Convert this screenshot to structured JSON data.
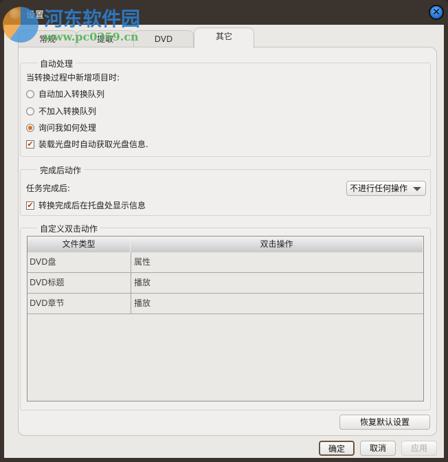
{
  "window": {
    "title": "设置",
    "watermark": {
      "name": "河东软件园",
      "url": "www.pc0359.cn"
    }
  },
  "tabs": [
    {
      "label": "常规"
    },
    {
      "label": "提取"
    },
    {
      "label": "DVD"
    },
    {
      "label": "其它",
      "active": true
    }
  ],
  "auto": {
    "legend": "自动处理",
    "prompt": "当转换过程中新增项目时:",
    "options": [
      {
        "label": "自动加入转换队列",
        "selected": false
      },
      {
        "label": "不加入转换队列",
        "selected": false
      },
      {
        "label": "询问我如何处理",
        "selected": true
      }
    ],
    "check": {
      "label": "装载光盘时自动获取光盘信息.",
      "checked": true
    }
  },
  "after": {
    "legend": "完成后动作",
    "label": "任务完成后:",
    "combo_value": "不进行任何操作",
    "check": {
      "label": "转换完成后在托盘处显示信息",
      "checked": true
    }
  },
  "dbl": {
    "legend": "自定义双击动作",
    "columns": [
      "文件类型",
      "双击操作"
    ],
    "rows": [
      [
        "DVD盘",
        "属性"
      ],
      [
        "DVD标题",
        "播放"
      ],
      [
        "DVD章节",
        "播放"
      ]
    ]
  },
  "buttons": {
    "restore": "恢复默认设置",
    "ok": "确定",
    "cancel": "取消",
    "apply": "应用"
  },
  "icons": {
    "close": "✕",
    "check": "✔"
  }
}
